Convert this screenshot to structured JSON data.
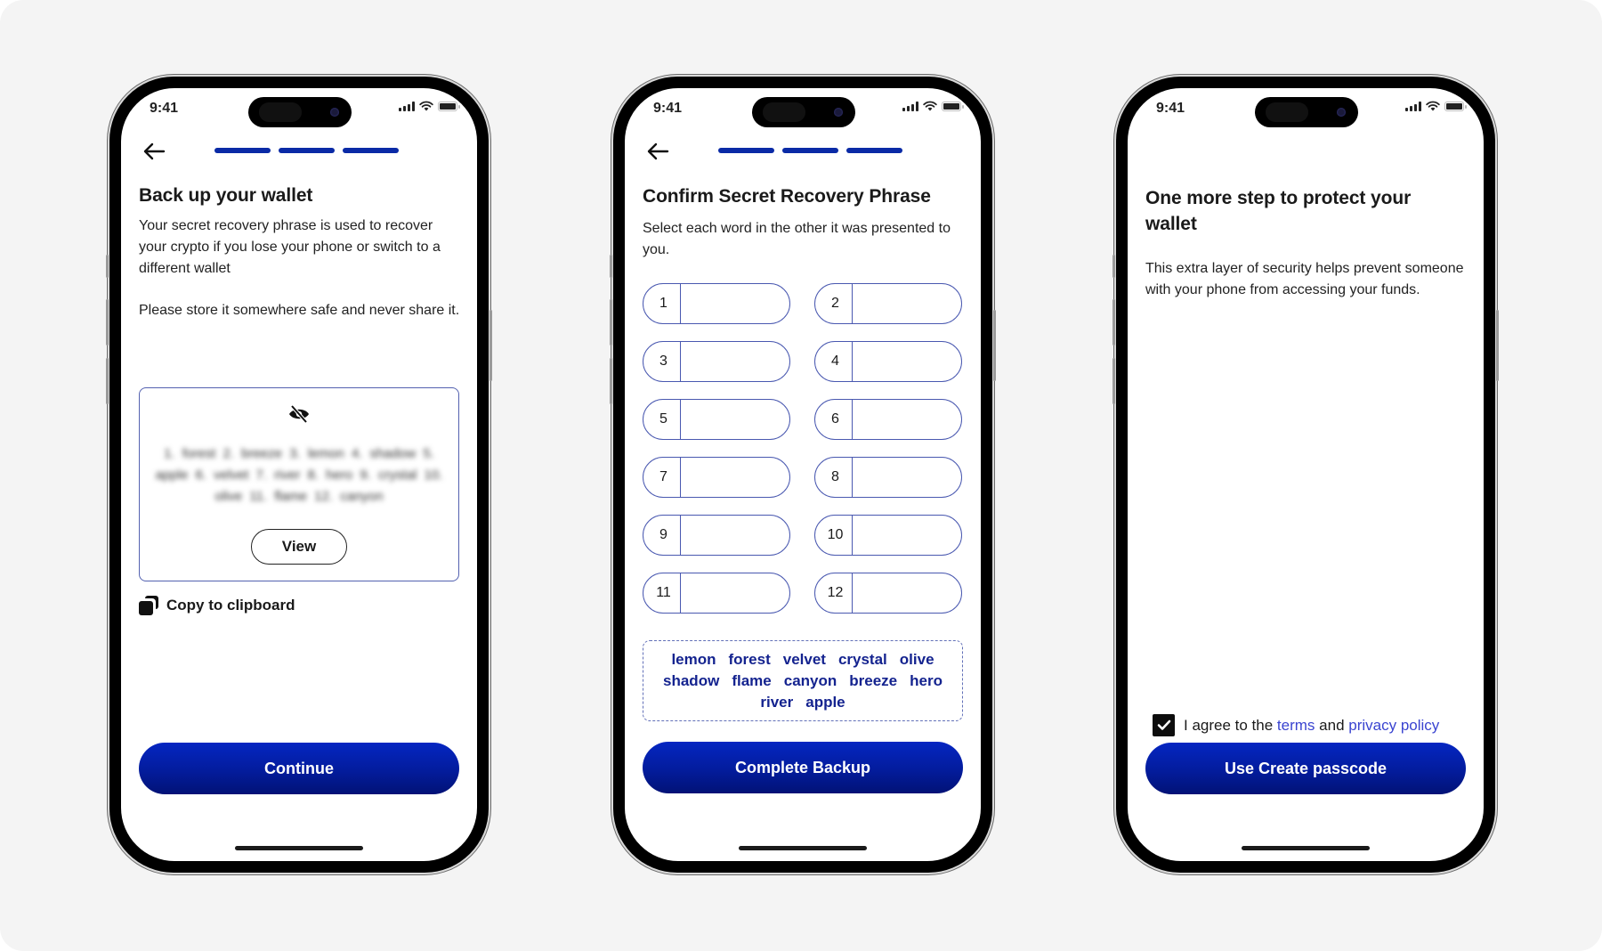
{
  "status_bar": {
    "time": "9:41"
  },
  "screens": {
    "backup": {
      "title": "Back up your wallet",
      "paragraph1": "Your secret recovery phrase is used to recover your crypto if you lose your phone or switch to a different wallet",
      "paragraph2": "Please store it somewhere safe and never share it.",
      "hidden_phrase": "1. forest  2. breeze  3. lemon  4. shadow  5. apple  6. velvet  7. river  8. hero  9. crystal  10. olive  11. flame  12. canyon",
      "view_label": "View",
      "copy_label": "Copy to clipboard",
      "continue_label": "Continue",
      "progress_steps_total": 3,
      "progress_steps_complete": 3
    },
    "confirm": {
      "title": "Confirm Secret Recovery Phrase",
      "paragraph1": "Select each word in the other it was presented to you.",
      "slots": [
        {
          "num": "1",
          "value": ""
        },
        {
          "num": "2",
          "value": ""
        },
        {
          "num": "3",
          "value": ""
        },
        {
          "num": "4",
          "value": ""
        },
        {
          "num": "5",
          "value": ""
        },
        {
          "num": "6",
          "value": ""
        },
        {
          "num": "7",
          "value": ""
        },
        {
          "num": "8",
          "value": ""
        },
        {
          "num": "9",
          "value": ""
        },
        {
          "num": "10",
          "value": ""
        },
        {
          "num": "11",
          "value": ""
        },
        {
          "num": "12",
          "value": ""
        }
      ],
      "word_bank": [
        "lemon",
        "forest",
        "velvet",
        "crystal",
        "olive",
        "shadow",
        "flame",
        "canyon",
        "breeze",
        "hero",
        "river",
        "apple"
      ],
      "complete_label": "Complete Backup",
      "progress_steps_total": 3,
      "progress_steps_complete": 3
    },
    "protect": {
      "title": "One more step to protect your wallet",
      "paragraph1": "This extra layer of security helps prevent someone with your phone from accessing your funds.",
      "agree_prefix": "I agree to the",
      "terms_link": "terms",
      "agree_and": "and",
      "privacy_link": "privacy policy",
      "agree_checked": true,
      "passcode_label": "Use Create passcode"
    }
  },
  "colors": {
    "primary": "#031c9c",
    "link": "#3a44d0",
    "outline": "#4958b0",
    "background": "#f4f4f4"
  }
}
